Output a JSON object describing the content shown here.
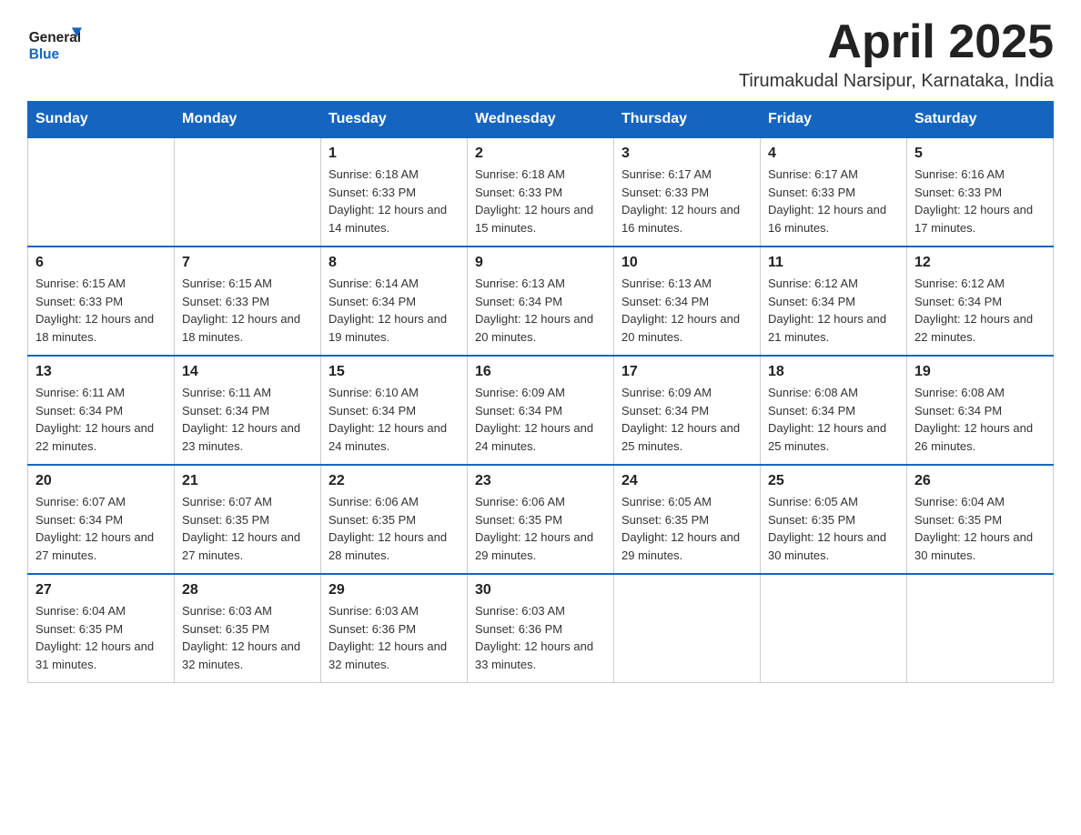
{
  "header": {
    "logo_general": "General",
    "logo_blue": "Blue",
    "month": "April 2025",
    "location": "Tirumakudal Narsipur, Karnataka, India"
  },
  "weekdays": [
    "Sunday",
    "Monday",
    "Tuesday",
    "Wednesday",
    "Thursday",
    "Friday",
    "Saturday"
  ],
  "weeks": [
    [
      {
        "day": "",
        "sunrise": "",
        "sunset": "",
        "daylight": ""
      },
      {
        "day": "",
        "sunrise": "",
        "sunset": "",
        "daylight": ""
      },
      {
        "day": "1",
        "sunrise": "Sunrise: 6:18 AM",
        "sunset": "Sunset: 6:33 PM",
        "daylight": "Daylight: 12 hours and 14 minutes."
      },
      {
        "day": "2",
        "sunrise": "Sunrise: 6:18 AM",
        "sunset": "Sunset: 6:33 PM",
        "daylight": "Daylight: 12 hours and 15 minutes."
      },
      {
        "day": "3",
        "sunrise": "Sunrise: 6:17 AM",
        "sunset": "Sunset: 6:33 PM",
        "daylight": "Daylight: 12 hours and 16 minutes."
      },
      {
        "day": "4",
        "sunrise": "Sunrise: 6:17 AM",
        "sunset": "Sunset: 6:33 PM",
        "daylight": "Daylight: 12 hours and 16 minutes."
      },
      {
        "day": "5",
        "sunrise": "Sunrise: 6:16 AM",
        "sunset": "Sunset: 6:33 PM",
        "daylight": "Daylight: 12 hours and 17 minutes."
      }
    ],
    [
      {
        "day": "6",
        "sunrise": "Sunrise: 6:15 AM",
        "sunset": "Sunset: 6:33 PM",
        "daylight": "Daylight: 12 hours and 18 minutes."
      },
      {
        "day": "7",
        "sunrise": "Sunrise: 6:15 AM",
        "sunset": "Sunset: 6:33 PM",
        "daylight": "Daylight: 12 hours and 18 minutes."
      },
      {
        "day": "8",
        "sunrise": "Sunrise: 6:14 AM",
        "sunset": "Sunset: 6:34 PM",
        "daylight": "Daylight: 12 hours and 19 minutes."
      },
      {
        "day": "9",
        "sunrise": "Sunrise: 6:13 AM",
        "sunset": "Sunset: 6:34 PM",
        "daylight": "Daylight: 12 hours and 20 minutes."
      },
      {
        "day": "10",
        "sunrise": "Sunrise: 6:13 AM",
        "sunset": "Sunset: 6:34 PM",
        "daylight": "Daylight: 12 hours and 20 minutes."
      },
      {
        "day": "11",
        "sunrise": "Sunrise: 6:12 AM",
        "sunset": "Sunset: 6:34 PM",
        "daylight": "Daylight: 12 hours and 21 minutes."
      },
      {
        "day": "12",
        "sunrise": "Sunrise: 6:12 AM",
        "sunset": "Sunset: 6:34 PM",
        "daylight": "Daylight: 12 hours and 22 minutes."
      }
    ],
    [
      {
        "day": "13",
        "sunrise": "Sunrise: 6:11 AM",
        "sunset": "Sunset: 6:34 PM",
        "daylight": "Daylight: 12 hours and 22 minutes."
      },
      {
        "day": "14",
        "sunrise": "Sunrise: 6:11 AM",
        "sunset": "Sunset: 6:34 PM",
        "daylight": "Daylight: 12 hours and 23 minutes."
      },
      {
        "day": "15",
        "sunrise": "Sunrise: 6:10 AM",
        "sunset": "Sunset: 6:34 PM",
        "daylight": "Daylight: 12 hours and 24 minutes."
      },
      {
        "day": "16",
        "sunrise": "Sunrise: 6:09 AM",
        "sunset": "Sunset: 6:34 PM",
        "daylight": "Daylight: 12 hours and 24 minutes."
      },
      {
        "day": "17",
        "sunrise": "Sunrise: 6:09 AM",
        "sunset": "Sunset: 6:34 PM",
        "daylight": "Daylight: 12 hours and 25 minutes."
      },
      {
        "day": "18",
        "sunrise": "Sunrise: 6:08 AM",
        "sunset": "Sunset: 6:34 PM",
        "daylight": "Daylight: 12 hours and 25 minutes."
      },
      {
        "day": "19",
        "sunrise": "Sunrise: 6:08 AM",
        "sunset": "Sunset: 6:34 PM",
        "daylight": "Daylight: 12 hours and 26 minutes."
      }
    ],
    [
      {
        "day": "20",
        "sunrise": "Sunrise: 6:07 AM",
        "sunset": "Sunset: 6:34 PM",
        "daylight": "Daylight: 12 hours and 27 minutes."
      },
      {
        "day": "21",
        "sunrise": "Sunrise: 6:07 AM",
        "sunset": "Sunset: 6:35 PM",
        "daylight": "Daylight: 12 hours and 27 minutes."
      },
      {
        "day": "22",
        "sunrise": "Sunrise: 6:06 AM",
        "sunset": "Sunset: 6:35 PM",
        "daylight": "Daylight: 12 hours and 28 minutes."
      },
      {
        "day": "23",
        "sunrise": "Sunrise: 6:06 AM",
        "sunset": "Sunset: 6:35 PM",
        "daylight": "Daylight: 12 hours and 29 minutes."
      },
      {
        "day": "24",
        "sunrise": "Sunrise: 6:05 AM",
        "sunset": "Sunset: 6:35 PM",
        "daylight": "Daylight: 12 hours and 29 minutes."
      },
      {
        "day": "25",
        "sunrise": "Sunrise: 6:05 AM",
        "sunset": "Sunset: 6:35 PM",
        "daylight": "Daylight: 12 hours and 30 minutes."
      },
      {
        "day": "26",
        "sunrise": "Sunrise: 6:04 AM",
        "sunset": "Sunset: 6:35 PM",
        "daylight": "Daylight: 12 hours and 30 minutes."
      }
    ],
    [
      {
        "day": "27",
        "sunrise": "Sunrise: 6:04 AM",
        "sunset": "Sunset: 6:35 PM",
        "daylight": "Daylight: 12 hours and 31 minutes."
      },
      {
        "day": "28",
        "sunrise": "Sunrise: 6:03 AM",
        "sunset": "Sunset: 6:35 PM",
        "daylight": "Daylight: 12 hours and 32 minutes."
      },
      {
        "day": "29",
        "sunrise": "Sunrise: 6:03 AM",
        "sunset": "Sunset: 6:36 PM",
        "daylight": "Daylight: 12 hours and 32 minutes."
      },
      {
        "day": "30",
        "sunrise": "Sunrise: 6:03 AM",
        "sunset": "Sunset: 6:36 PM",
        "daylight": "Daylight: 12 hours and 33 minutes."
      },
      {
        "day": "",
        "sunrise": "",
        "sunset": "",
        "daylight": ""
      },
      {
        "day": "",
        "sunrise": "",
        "sunset": "",
        "daylight": ""
      },
      {
        "day": "",
        "sunrise": "",
        "sunset": "",
        "daylight": ""
      }
    ]
  ]
}
